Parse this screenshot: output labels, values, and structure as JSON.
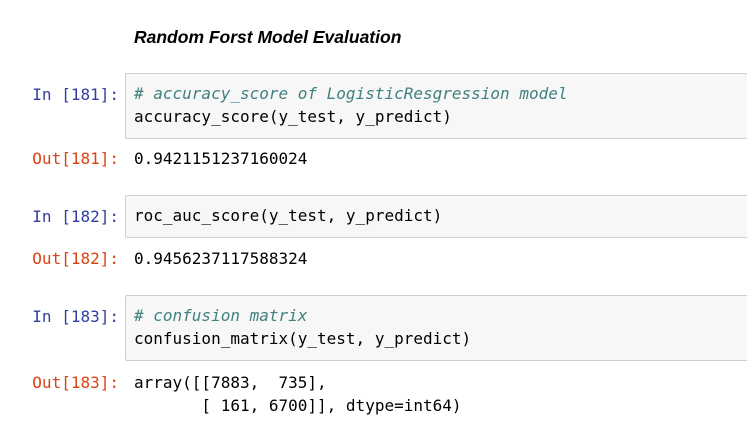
{
  "heading": "Random Forst Model Evaluation",
  "cells": [
    {
      "in_prompt": "In [181]:",
      "comment": "# accuracy_score of LogisticResgression model",
      "code": "accuracy_score(y_test, y_predict)",
      "out_prompt": "Out[181]:",
      "output": [
        "0.9421151237160024"
      ]
    },
    {
      "in_prompt": "In [182]:",
      "code": "roc_auc_score(y_test, y_predict)",
      "out_prompt": "Out[182]:",
      "output": [
        "0.9456237117588324"
      ]
    },
    {
      "in_prompt": "In [183]:",
      "comment": "# confusion matrix",
      "code": "confusion_matrix(y_test, y_predict)",
      "out_prompt": "Out[183]:",
      "output": [
        "array([[7883,  735],",
        "       [ 161, 6700]], dtype=int64)"
      ]
    }
  ]
}
